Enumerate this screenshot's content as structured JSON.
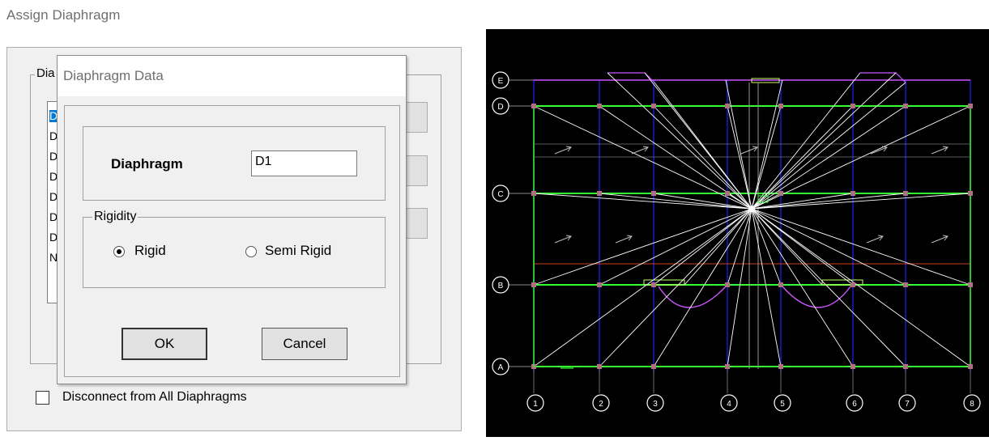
{
  "window": {
    "title": "Assign Diaphragm",
    "group_label_partial": "Dia",
    "list_items": [
      "D",
      "D",
      "D",
      "D",
      "D",
      "D",
      "D",
      "N"
    ],
    "disconnect_label": "Disconnect from All Diaphragms",
    "disconnect_checked": false
  },
  "dialog": {
    "title": "Diaphragm Data",
    "diaphragm_label": "Diaphragm",
    "diaphragm_value": "D1",
    "rigidity_label": "Rigidity",
    "rigid_label": "Rigid",
    "semi_rigid_label": "Semi Rigid",
    "selected_rigidity": "Rigid",
    "ok_label": "OK",
    "cancel_label": "Cancel"
  },
  "plan": {
    "row_grid_labels": [
      "E",
      "D",
      "C",
      "B",
      "A"
    ],
    "column_grid_labels": [
      "1",
      "2",
      "3",
      "4",
      "5",
      "6",
      "7",
      "8"
    ],
    "colors": {
      "background": "#000000",
      "grid_line": "#2020ff",
      "beam": "#33ff33",
      "diaphragm_link": "#ffffff",
      "slab_edge": "#cc55ff",
      "column": "#b07080",
      "bubble": "#ffffff"
    }
  }
}
